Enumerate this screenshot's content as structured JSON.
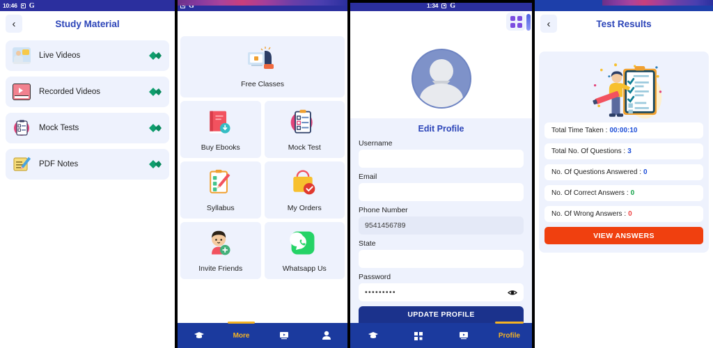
{
  "panels": {
    "study_material": {
      "status": {
        "time": "10:46",
        "icons": [
          "screenshot-icon",
          "google-icon"
        ]
      },
      "header": {
        "back": "‹",
        "title": "Study Material"
      },
      "items": [
        {
          "label": "Live Videos",
          "icon": "live-videos-icon"
        },
        {
          "label": "Recorded Videos",
          "icon": "recorded-videos-icon"
        },
        {
          "label": "Mock Tests",
          "icon": "mock-tests-icon"
        },
        {
          "label": "PDF Notes",
          "icon": "pdf-notes-icon"
        }
      ]
    },
    "dashboard": {
      "status": {
        "time": "",
        "icons": [
          "screenshot-icon",
          "google-icon"
        ]
      },
      "featured": {
        "label": "Free Classes",
        "icon": "free-classes-icon"
      },
      "tiles": [
        {
          "label": "Buy Ebooks",
          "icon": "ebook-icon"
        },
        {
          "label": "Mock Test",
          "icon": "clipboard-icon"
        },
        {
          "label": "Syllabus",
          "icon": "syllabus-icon"
        },
        {
          "label": "My Orders",
          "icon": "shopping-bag-icon"
        },
        {
          "label": "Invite Friends",
          "icon": "invite-friend-icon"
        },
        {
          "label": "Whatsapp Us",
          "icon": "whatsapp-icon"
        }
      ],
      "bottom_nav": [
        {
          "label": "",
          "icon": "graduation-cap-icon",
          "active": false
        },
        {
          "label": "More",
          "icon": "",
          "active": true
        },
        {
          "label": "",
          "icon": "video-icon",
          "active": false
        },
        {
          "label": "",
          "icon": "person-icon",
          "active": false
        }
      ]
    },
    "edit_profile": {
      "status": {
        "time": "1:34",
        "icons": [
          "screenshot-icon",
          "google-icon"
        ]
      },
      "grid_button": "grid-icon",
      "avatar": "default-avatar",
      "title": "Edit Profile",
      "fields": [
        {
          "label": "Username",
          "value": "",
          "type": "text",
          "filled": false
        },
        {
          "label": "Email",
          "value": "",
          "type": "text",
          "filled": false
        },
        {
          "label": "Phone Number",
          "value": "9541456789",
          "type": "tel",
          "filled": true
        },
        {
          "label": "State",
          "value": "",
          "type": "text",
          "filled": false
        },
        {
          "label": "Password",
          "value": "•••••••••",
          "type": "password",
          "filled": false
        }
      ],
      "submit_label": "UPDATE PROFILE",
      "bottom_nav": [
        {
          "label": "",
          "icon": "graduation-cap-icon",
          "active": false
        },
        {
          "label": "",
          "icon": "grid-icon",
          "active": false
        },
        {
          "label": "",
          "icon": "video-icon",
          "active": false
        },
        {
          "label": "Profile",
          "icon": "",
          "active": true
        }
      ]
    },
    "test_results": {
      "header": {
        "back": "‹",
        "title": "Test Results"
      },
      "illustration": "test-results-illustration",
      "rows": [
        {
          "label": "Total Time Taken :",
          "value": "00:00:10",
          "color": "#1d4ed8"
        },
        {
          "label": "Total No. Of Questions :",
          "value": "3",
          "color": "#1d4ed8"
        },
        {
          "label": "No. Of Questions Answered :",
          "value": "0",
          "color": "#1d4ed8"
        },
        {
          "label": "No. Of Correct Answers :",
          "value": "0",
          "color": "#16a34a"
        },
        {
          "label": "No. Of Wrong Answers :",
          "value": "0",
          "color": "#ef4444"
        }
      ],
      "view_answers_label": "VIEW ANSWERS"
    }
  },
  "colors": {
    "brand_blue": "#2b44b8",
    "nav_blue": "#1b3a9e",
    "card_lavender": "#eef2fd",
    "accent_yellow": "#f5b323",
    "accent_orange": "#f0400f",
    "arrow_green": "#0f9e6e",
    "status_navy": "#2b2f9e"
  }
}
